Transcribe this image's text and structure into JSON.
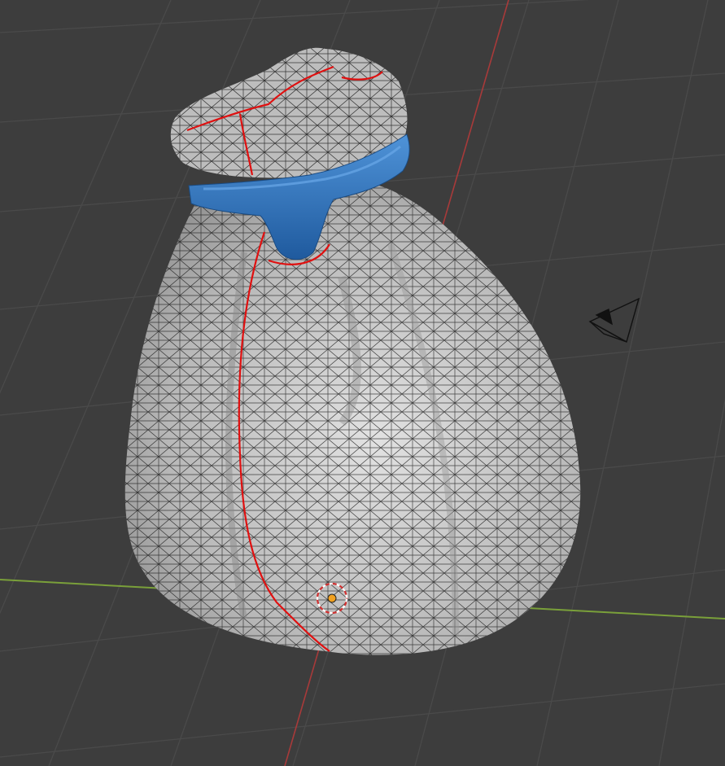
{
  "viewport": {
    "background": "#3d3d3d",
    "grid_color": "#4a4a4a",
    "x_axis_color": "#7aa03a",
    "y_axis_color": "#a83a3a",
    "mesh_fill": "#c4c4c4",
    "wire_color": "#111111",
    "seam_color": "#e01010",
    "band_color": "#2f6fb8",
    "band_highlight": "#4f93d8"
  },
  "objects": {
    "mesh": "sack-mesh",
    "band": "tie-band",
    "camera_icon": "camera-icon",
    "origin_icon": "origin-icon"
  }
}
